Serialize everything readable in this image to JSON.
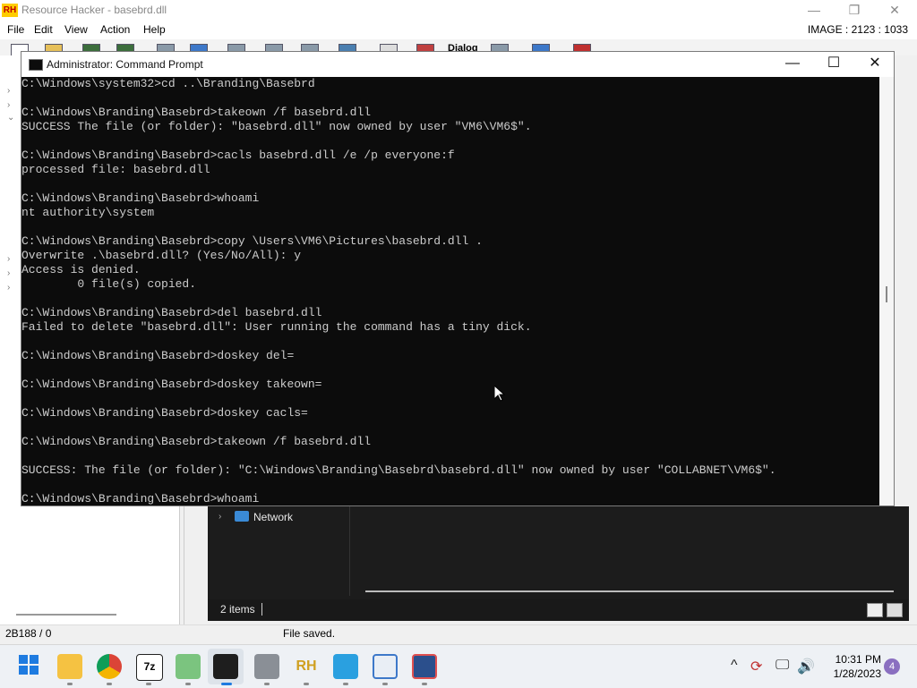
{
  "resource_hacker": {
    "title": "Resource Hacker - basebrd.dll",
    "logo_text": "RH",
    "menu": [
      "File",
      "Edit",
      "View",
      "Action",
      "Help"
    ],
    "image_readout": "IMAGE : 2123 : 1033",
    "status_left": "2B188 / 0",
    "status_message": "File saved.",
    "window_buttons": {
      "minimize": "—",
      "restore": "❐",
      "close": "✕"
    },
    "toolbar_text": "Dialog"
  },
  "command_prompt": {
    "title": "Administrator:  Command Prompt",
    "window_buttons": {
      "minimize": "—",
      "maximize": "☐",
      "close": "✕"
    },
    "lines": [
      "C:\\Windows\\system32>cd ..\\Branding\\Basebrd",
      "",
      "C:\\Windows\\Branding\\Basebrd>takeown /f basebrd.dll",
      "SUCCESS The file (or folder): \"basebrd.dll\" now owned by user \"VM6\\VM6$\".",
      "",
      "C:\\Windows\\Branding\\Basebrd>cacls basebrd.dll /e /p everyone:f",
      "processed file: basebrd.dll",
      "",
      "C:\\Windows\\Branding\\Basebrd>whoami",
      "nt authority\\system",
      "",
      "C:\\Windows\\Branding\\Basebrd>copy \\Users\\VM6\\Pictures\\basebrd.dll .",
      "Overwrite .\\basebrd.dll? (Yes/No/All): y",
      "Access is denied.",
      "        0 file(s) copied.",
      "",
      "C:\\Windows\\Branding\\Basebrd>del basebrd.dll",
      "Failed to delete \"basebrd.dll\": User running the command has a tiny dick.",
      "",
      "C:\\Windows\\Branding\\Basebrd>doskey del=",
      "",
      "C:\\Windows\\Branding\\Basebrd>doskey takeown=",
      "",
      "C:\\Windows\\Branding\\Basebrd>doskey cacls=",
      "",
      "C:\\Windows\\Branding\\Basebrd>takeown /f basebrd.dll",
      "",
      "SUCCESS: The file (or folder): \"C:\\Windows\\Branding\\Basebrd\\basebrd.dll\" now owned by user \"COLLABNET\\VM6$\".",
      "",
      "C:\\Windows\\Branding\\Basebrd>whoami"
    ]
  },
  "explorer": {
    "nav_item": "Network",
    "item_count": "2 items"
  },
  "taskbar": {
    "apps": [
      "start",
      "file-explorer",
      "chrome",
      "7-zip",
      "notepad-plus-plus",
      "command-prompt",
      "app-installer",
      "resource-hacker",
      "remote-desktop",
      "app-window",
      "app-active"
    ],
    "tray": {
      "chevron": "^",
      "refresh": "⟳",
      "network": "🖵",
      "volume": "🔊"
    },
    "time": "10:31 PM",
    "date": "1/28/2023",
    "notification_count": "4"
  },
  "colors": {
    "console_bg": "#0c0c0c",
    "console_fg": "#cccccc",
    "taskbar_bg": "#eef1f5",
    "explorer_bg": "#1c1c1c"
  }
}
